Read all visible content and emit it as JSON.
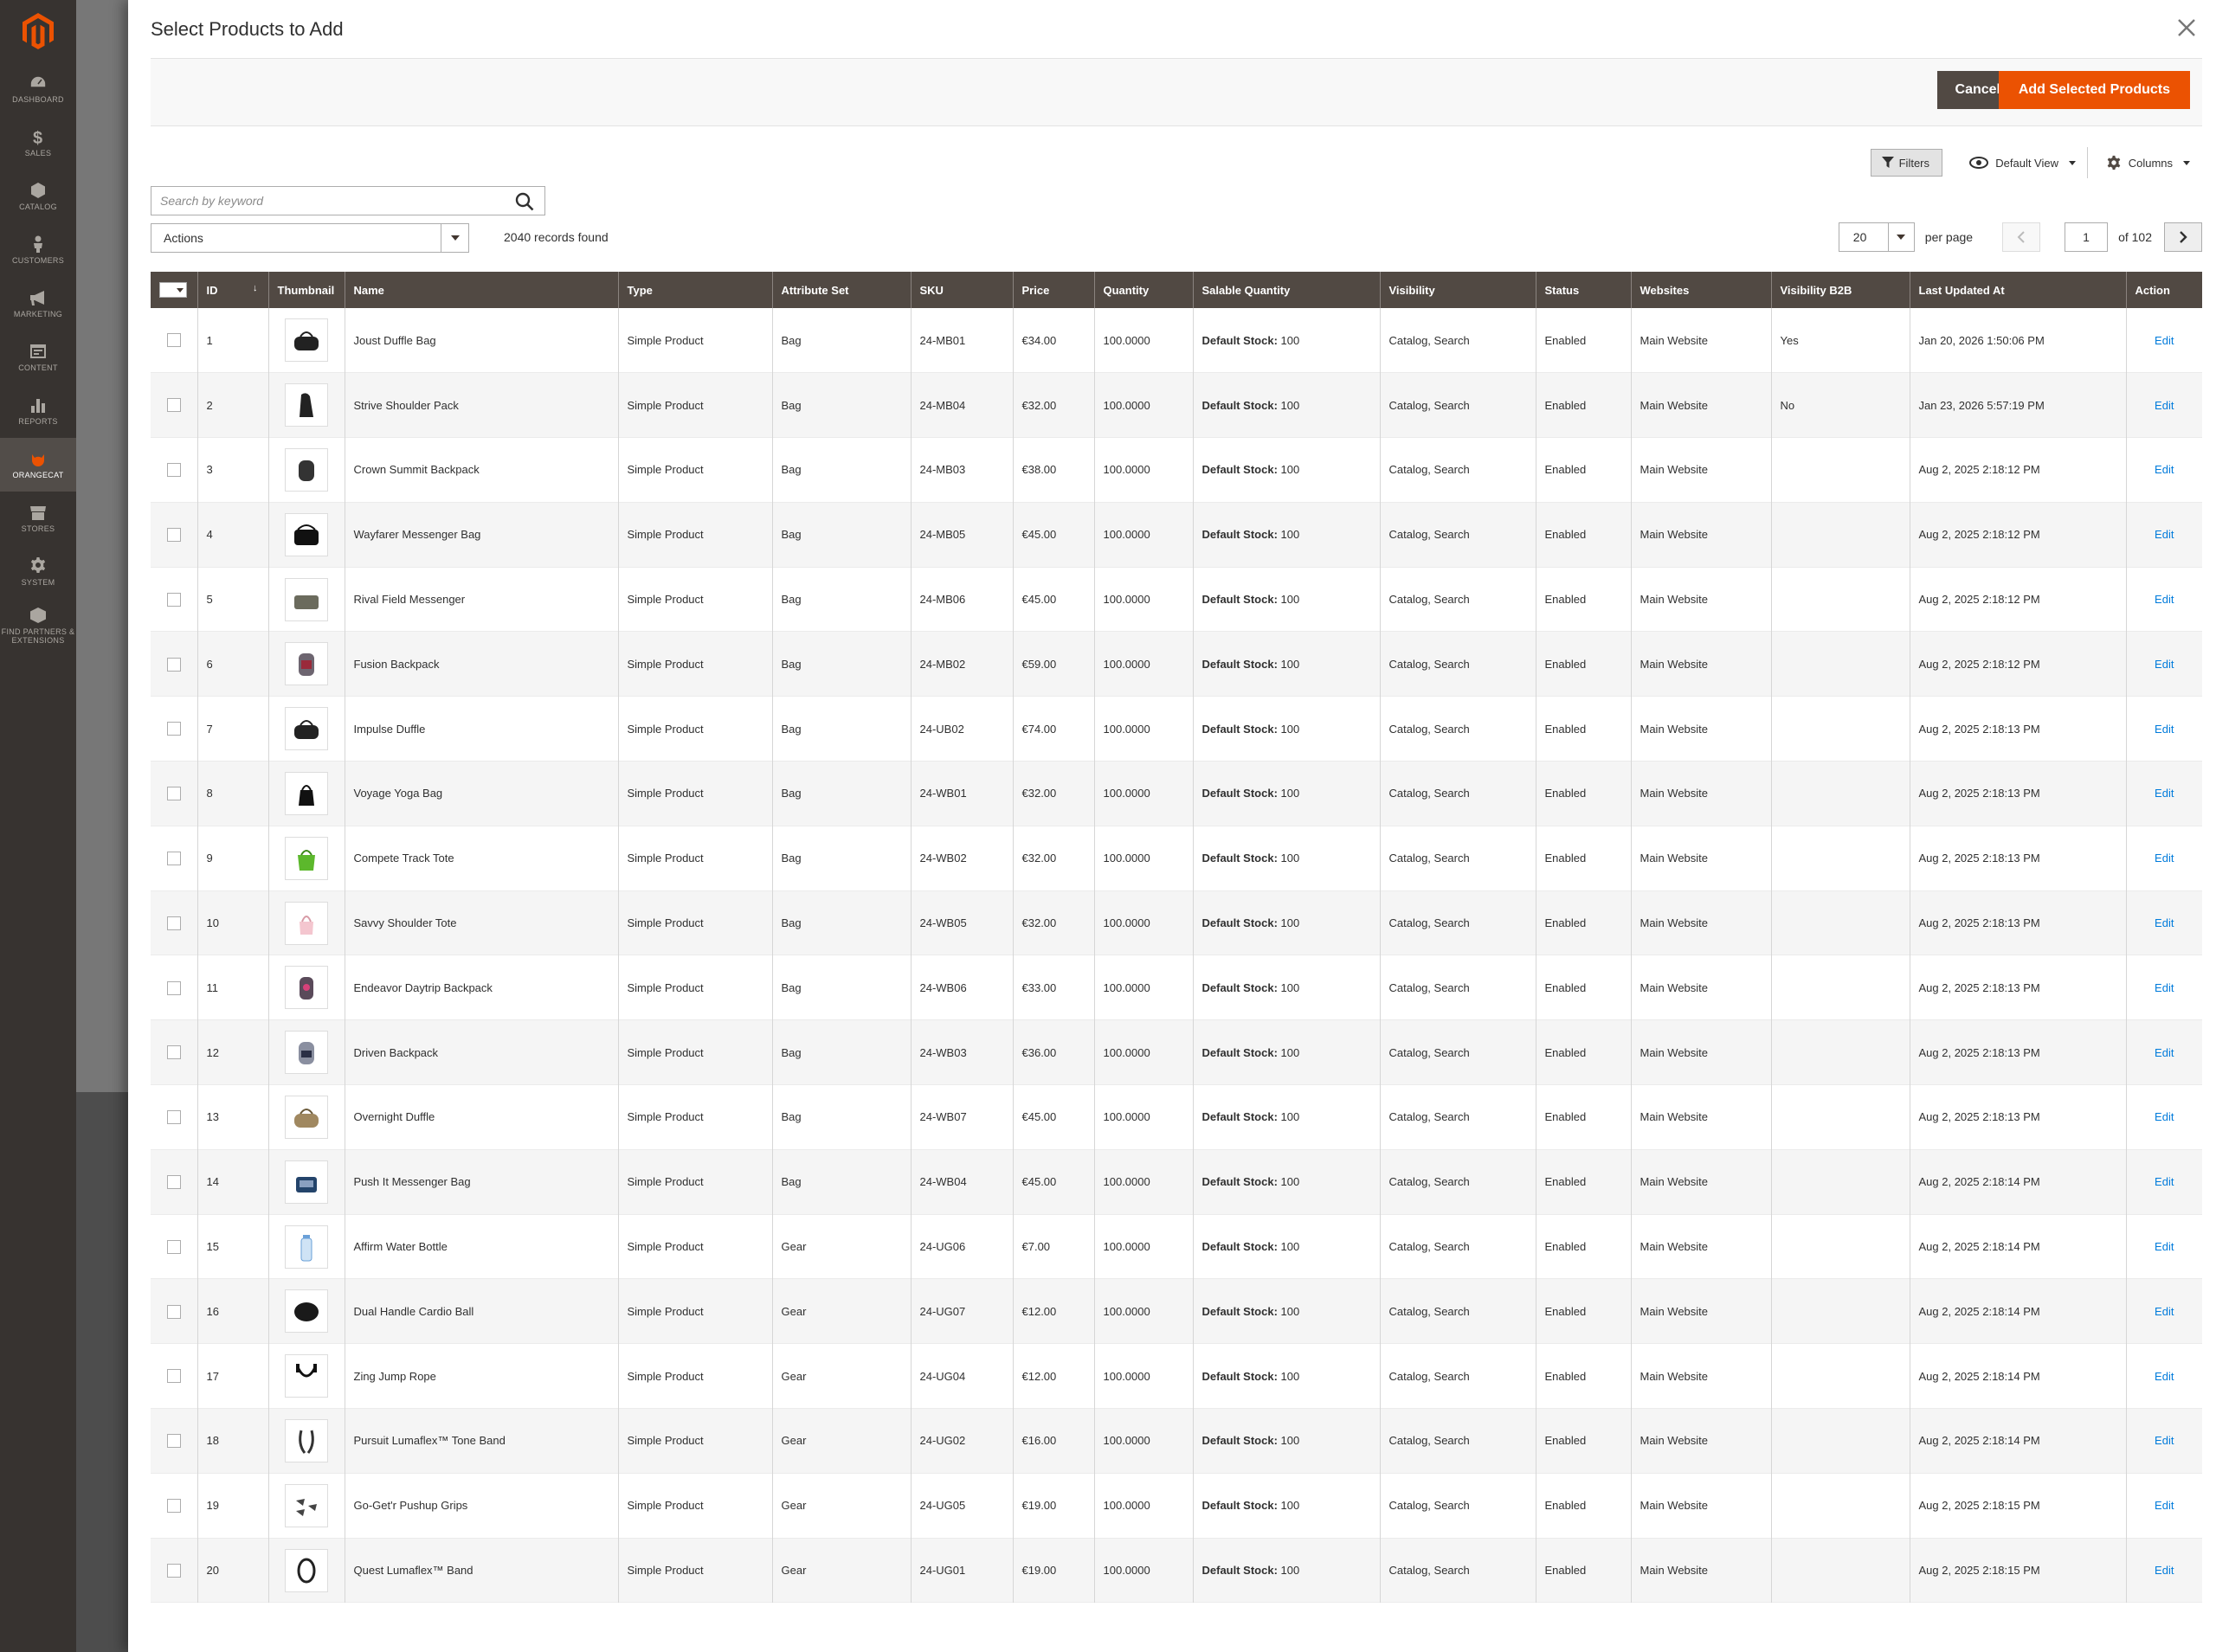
{
  "admin_nav": [
    {
      "label": "Dashboard",
      "icon": "dashboard-icon"
    },
    {
      "label": "Sales",
      "icon": "dollar-icon"
    },
    {
      "label": "Catalog",
      "icon": "cube-icon"
    },
    {
      "label": "Customers",
      "icon": "person-icon"
    },
    {
      "label": "Marketing",
      "icon": "megaphone-icon"
    },
    {
      "label": "Content",
      "icon": "layout-icon"
    },
    {
      "label": "Reports",
      "icon": "bar-chart-icon"
    },
    {
      "label": "OrangeCat",
      "icon": "cat-icon"
    },
    {
      "label": "Stores",
      "icon": "store-icon"
    },
    {
      "label": "System",
      "icon": "gear-icon"
    },
    {
      "label": "Find Partners & Extensions",
      "icon": "box-icon"
    }
  ],
  "modal": {
    "title": "Select Products to Add",
    "cancel_label": "Cancel",
    "add_label": "Add Selected Products"
  },
  "toolbar": {
    "filters_label": "Filters",
    "view_label": "Default View",
    "columns_label": "Columns",
    "search_placeholder": "Search by keyword",
    "actions_label": "Actions",
    "records_found": "2040 records found",
    "per_page_value": "20",
    "per_page_label": "per page",
    "current_page": "1",
    "page_of": "of 102"
  },
  "columns": [
    "ID",
    "Thumbnail",
    "Name",
    "Type",
    "Attribute Set",
    "SKU",
    "Price",
    "Quantity",
    "Salable Quantity",
    "Visibility",
    "Status",
    "Websites",
    "Visibility B2B",
    "Last Updated At",
    "Action"
  ],
  "stock_label": "Default Stock:",
  "rows": [
    {
      "id": "1",
      "name": "Joust Duffle Bag",
      "type": "Simple Product",
      "attr": "Bag",
      "sku": "24-MB01",
      "price": "€34.00",
      "qty": "100.0000",
      "stock": "100",
      "visibility": "Catalog, Search",
      "status": "Enabled",
      "website": "Main Website",
      "b2b": "Yes",
      "updated": "Jan 20, 2026 1:50:06 PM",
      "action": "Edit",
      "thumb": "duffle"
    },
    {
      "id": "2",
      "name": "Strive Shoulder Pack",
      "type": "Simple Product",
      "attr": "Bag",
      "sku": "24-MB04",
      "price": "€32.00",
      "qty": "100.0000",
      "stock": "100",
      "visibility": "Catalog, Search",
      "status": "Enabled",
      "website": "Main Website",
      "b2b": "No",
      "updated": "Jan 23, 2026 5:57:19 PM",
      "action": "Edit",
      "thumb": "pack"
    },
    {
      "id": "3",
      "name": "Crown Summit Backpack",
      "type": "Simple Product",
      "attr": "Bag",
      "sku": "24-MB03",
      "price": "€38.00",
      "qty": "100.0000",
      "stock": "100",
      "visibility": "Catalog, Search",
      "status": "Enabled",
      "website": "Main Website",
      "b2b": "",
      "updated": "Aug 2, 2025 2:18:12 PM",
      "action": "Edit",
      "thumb": "backpack"
    },
    {
      "id": "4",
      "name": "Wayfarer Messenger Bag",
      "type": "Simple Product",
      "attr": "Bag",
      "sku": "24-MB05",
      "price": "€45.00",
      "qty": "100.0000",
      "stock": "100",
      "visibility": "Catalog, Search",
      "status": "Enabled",
      "website": "Main Website",
      "b2b": "",
      "updated": "Aug 2, 2025 2:18:12 PM",
      "action": "Edit",
      "thumb": "messenger"
    },
    {
      "id": "5",
      "name": "Rival Field Messenger",
      "type": "Simple Product",
      "attr": "Bag",
      "sku": "24-MB06",
      "price": "€45.00",
      "qty": "100.0000",
      "stock": "100",
      "visibility": "Catalog, Search",
      "status": "Enabled",
      "website": "Main Website",
      "b2b": "",
      "updated": "Aug 2, 2025 2:18:12 PM",
      "action": "Edit",
      "thumb": "field"
    },
    {
      "id": "6",
      "name": "Fusion Backpack",
      "type": "Simple Product",
      "attr": "Bag",
      "sku": "24-MB02",
      "price": "€59.00",
      "qty": "100.0000",
      "stock": "100",
      "visibility": "Catalog, Search",
      "status": "Enabled",
      "website": "Main Website",
      "b2b": "",
      "updated": "Aug 2, 2025 2:18:12 PM",
      "action": "Edit",
      "thumb": "backpack2"
    },
    {
      "id": "7",
      "name": "Impulse Duffle",
      "type": "Simple Product",
      "attr": "Bag",
      "sku": "24-UB02",
      "price": "€74.00",
      "qty": "100.0000",
      "stock": "100",
      "visibility": "Catalog, Search",
      "status": "Enabled",
      "website": "Main Website",
      "b2b": "",
      "updated": "Aug 2, 2025 2:18:13 PM",
      "action": "Edit",
      "thumb": "duffle"
    },
    {
      "id": "8",
      "name": "Voyage Yoga Bag",
      "type": "Simple Product",
      "attr": "Bag",
      "sku": "24-WB01",
      "price": "€32.00",
      "qty": "100.0000",
      "stock": "100",
      "visibility": "Catalog, Search",
      "status": "Enabled",
      "website": "Main Website",
      "b2b": "",
      "updated": "Aug 2, 2025 2:18:13 PM",
      "action": "Edit",
      "thumb": "tote"
    },
    {
      "id": "9",
      "name": "Compete Track Tote",
      "type": "Simple Product",
      "attr": "Bag",
      "sku": "24-WB02",
      "price": "€32.00",
      "qty": "100.0000",
      "stock": "100",
      "visibility": "Catalog, Search",
      "status": "Enabled",
      "website": "Main Website",
      "b2b": "",
      "updated": "Aug 2, 2025 2:18:13 PM",
      "action": "Edit",
      "thumb": "greentote"
    },
    {
      "id": "10",
      "name": "Savvy Shoulder Tote",
      "type": "Simple Product",
      "attr": "Bag",
      "sku": "24-WB05",
      "price": "€32.00",
      "qty": "100.0000",
      "stock": "100",
      "visibility": "Catalog, Search",
      "status": "Enabled",
      "website": "Main Website",
      "b2b": "",
      "updated": "Aug 2, 2025 2:18:13 PM",
      "action": "Edit",
      "thumb": "pinktote"
    },
    {
      "id": "11",
      "name": "Endeavor Daytrip Backpack",
      "type": "Simple Product",
      "attr": "Bag",
      "sku": "24-WB06",
      "price": "€33.00",
      "qty": "100.0000",
      "stock": "100",
      "visibility": "Catalog, Search",
      "status": "Enabled",
      "website": "Main Website",
      "b2b": "",
      "updated": "Aug 2, 2025 2:18:13 PM",
      "action": "Edit",
      "thumb": "backpack3"
    },
    {
      "id": "12",
      "name": "Driven Backpack",
      "type": "Simple Product",
      "attr": "Bag",
      "sku": "24-WB03",
      "price": "€36.00",
      "qty": "100.0000",
      "stock": "100",
      "visibility": "Catalog, Search",
      "status": "Enabled",
      "website": "Main Website",
      "b2b": "",
      "updated": "Aug 2, 2025 2:18:13 PM",
      "action": "Edit",
      "thumb": "backpack4"
    },
    {
      "id": "13",
      "name": "Overnight Duffle",
      "type": "Simple Product",
      "attr": "Bag",
      "sku": "24-WB07",
      "price": "€45.00",
      "qty": "100.0000",
      "stock": "100",
      "visibility": "Catalog, Search",
      "status": "Enabled",
      "website": "Main Website",
      "b2b": "",
      "updated": "Aug 2, 2025 2:18:13 PM",
      "action": "Edit",
      "thumb": "tanduffle"
    },
    {
      "id": "14",
      "name": "Push It Messenger Bag",
      "type": "Simple Product",
      "attr": "Bag",
      "sku": "24-WB04",
      "price": "€45.00",
      "qty": "100.0000",
      "stock": "100",
      "visibility": "Catalog, Search",
      "status": "Enabled",
      "website": "Main Website",
      "b2b": "",
      "updated": "Aug 2, 2025 2:18:14 PM",
      "action": "Edit",
      "thumb": "bluebag"
    },
    {
      "id": "15",
      "name": "Affirm Water Bottle",
      "type": "Simple Product",
      "attr": "Gear",
      "sku": "24-UG06",
      "price": "€7.00",
      "qty": "100.0000",
      "stock": "100",
      "visibility": "Catalog, Search",
      "status": "Enabled",
      "website": "Main Website",
      "b2b": "",
      "updated": "Aug 2, 2025 2:18:14 PM",
      "action": "Edit",
      "thumb": "bottle"
    },
    {
      "id": "16",
      "name": "Dual Handle Cardio Ball",
      "type": "Simple Product",
      "attr": "Gear",
      "sku": "24-UG07",
      "price": "€12.00",
      "qty": "100.0000",
      "stock": "100",
      "visibility": "Catalog, Search",
      "status": "Enabled",
      "website": "Main Website",
      "b2b": "",
      "updated": "Aug 2, 2025 2:18:14 PM",
      "action": "Edit",
      "thumb": "ball"
    },
    {
      "id": "17",
      "name": "Zing Jump Rope",
      "type": "Simple Product",
      "attr": "Gear",
      "sku": "24-UG04",
      "price": "€12.00",
      "qty": "100.0000",
      "stock": "100",
      "visibility": "Catalog, Search",
      "status": "Enabled",
      "website": "Main Website",
      "b2b": "",
      "updated": "Aug 2, 2025 2:18:14 PM",
      "action": "Edit",
      "thumb": "rope"
    },
    {
      "id": "18",
      "name": "Pursuit Lumaflex™ Tone Band",
      "type": "Simple Product",
      "attr": "Gear",
      "sku": "24-UG02",
      "price": "€16.00",
      "qty": "100.0000",
      "stock": "100",
      "visibility": "Catalog, Search",
      "status": "Enabled",
      "website": "Main Website",
      "b2b": "",
      "updated": "Aug 2, 2025 2:18:14 PM",
      "action": "Edit",
      "thumb": "band"
    },
    {
      "id": "19",
      "name": "Go-Get'r Pushup Grips",
      "type": "Simple Product",
      "attr": "Gear",
      "sku": "24-UG05",
      "price": "€19.00",
      "qty": "100.0000",
      "stock": "100",
      "visibility": "Catalog, Search",
      "status": "Enabled",
      "website": "Main Website",
      "b2b": "",
      "updated": "Aug 2, 2025 2:18:15 PM",
      "action": "Edit",
      "thumb": "grips"
    },
    {
      "id": "20",
      "name": "Quest Lumaflex™ Band",
      "type": "Simple Product",
      "attr": "Gear",
      "sku": "24-UG01",
      "price": "€19.00",
      "qty": "100.0000",
      "stock": "100",
      "visibility": "Catalog, Search",
      "status": "Enabled",
      "website": "Main Website",
      "b2b": "",
      "updated": "Aug 2, 2025 2:18:15 PM",
      "action": "Edit",
      "thumb": "band2"
    }
  ],
  "colors": {
    "accent": "#eb5202",
    "header_bg": "#514943",
    "link": "#007bdb",
    "nav_bg": "#373330"
  }
}
